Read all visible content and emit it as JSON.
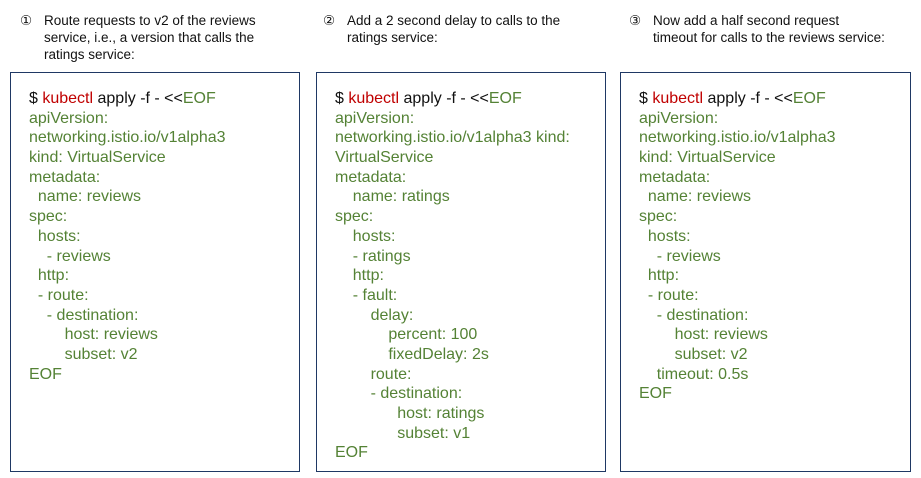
{
  "steps": [
    {
      "number": "①",
      "caption": "Route requests to v2 of the reviews\nservice, i.e., a version that calls the\nratings service:",
      "command": {
        "prompt": "$ ",
        "program": "kubectl",
        "args": " apply -f - <<",
        "heredoc": "EOF"
      },
      "yaml_lines": [
        "apiVersion:",
        "networking.istio.io/v1alpha3",
        "kind: VirtualService",
        "metadata:",
        "  name: reviews",
        "spec:",
        "  hosts:",
        "    - reviews",
        "  http:",
        "  - route:",
        "    - destination:",
        "        host: reviews",
        "        subset: v2",
        "EOF"
      ]
    },
    {
      "number": "②",
      "caption": "Add a 2 second delay to calls to the\nratings service:",
      "command": {
        "prompt": "$ ",
        "program": "kubectl",
        "args": " apply -f - <<",
        "heredoc": "EOF"
      },
      "yaml_lines": [
        "apiVersion:",
        "networking.istio.io/v1alpha3 kind:",
        "VirtualService",
        "metadata:",
        "    name: ratings",
        "spec:",
        "    hosts:",
        "    - ratings",
        "    http:",
        "    - fault:",
        "        delay:",
        "            percent: 100",
        "            fixedDelay: 2s",
        "        route:",
        "        - destination:",
        "              host: ratings",
        "              subset: v1",
        "EOF"
      ]
    },
    {
      "number": "③",
      "caption": "Now add a half second request\ntimeout for calls to the reviews service:",
      "command": {
        "prompt": "$ ",
        "program": "kubectl",
        "args": " apply -f - <<",
        "heredoc": "EOF"
      },
      "yaml_lines": [
        "apiVersion:",
        "networking.istio.io/v1alpha3",
        "kind: VirtualService",
        "metadata:",
        "  name: reviews",
        "spec:",
        "  hosts:",
        "    - reviews",
        "  http:",
        "  - route:",
        "    - destination:",
        "        host: reviews",
        "        subset: v2",
        "    timeout: 0.5s",
        "EOF"
      ]
    }
  ],
  "colors": {
    "border": "#1f3864",
    "command": "#c00000",
    "yaml": "#548235",
    "text": "#111111"
  }
}
